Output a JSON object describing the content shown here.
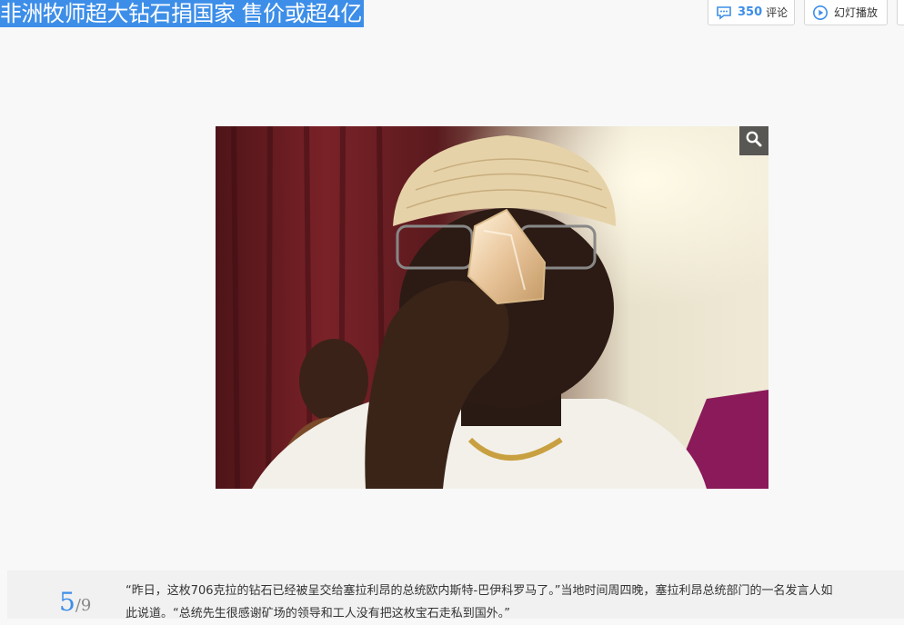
{
  "header": {
    "title": "非洲牧师超大钻石捐国家 售价或超4亿"
  },
  "toolbar": {
    "comment_count": "350",
    "comment_label": "评论",
    "slideshow_label": "幻灯播放",
    "accent_color": "#3d8ee8"
  },
  "photo": {
    "zoom_icon": "magnifier-icon"
  },
  "pager": {
    "current": "5",
    "separator": "/",
    "total": "9"
  },
  "caption": {
    "line1": "“昨日，这枚706克拉的钻石已经被呈交给塞拉利昂的总统欧内斯特-巴伊科罗马了。”当地时间周四晚，塞拉利昂总统部门的一名发言人如",
    "line2": "此说道。“总统先生很感谢矿场的领导和工人没有把这枚宝石走私到国外。”"
  }
}
